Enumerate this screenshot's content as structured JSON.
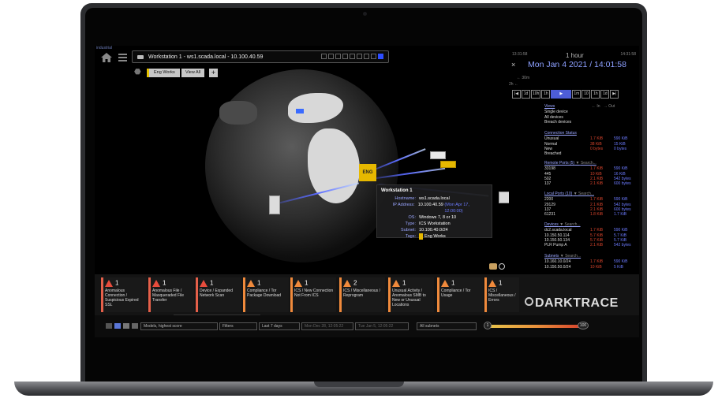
{
  "app": {
    "top_label": "industrial",
    "device_title": "Workstation 1 - ws1.scada.local - 10.100.40.59",
    "tag_chip": "Eng Works",
    "view_all": "View All",
    "add": "+"
  },
  "graph": {
    "eng_node_label": "ENG"
  },
  "tooltip": {
    "title": "Workstation 1",
    "rows": [
      {
        "k": "Hostname:",
        "v": "ws1.scada.local",
        "extra": ""
      },
      {
        "k": "IP Address:",
        "v": "10.100.40.59",
        "extra": "(Mon Apr 17, 12:00:00)"
      },
      {
        "k": "OS:",
        "v": "Windows 7, 8 or 10",
        "extra": ""
      },
      {
        "k": "Type:",
        "v": "ICS Workstation",
        "extra": ""
      },
      {
        "k": "Subnet:",
        "v": "10.100.40.0/24",
        "extra": ""
      },
      {
        "k": "Tags:",
        "v": "Eng Works",
        "extra": ""
      }
    ]
  },
  "time": {
    "left_time": "13:31:58",
    "range": "1 hour",
    "right_time": "14:31:58",
    "date": "Mon Jan 4 2021 / 14:01:58",
    "zoom1": "← 30m",
    "zoom2": "2h ←",
    "controls": [
      "|◀",
      "1d",
      "10h",
      "1h",
      "▶",
      "1m",
      "10",
      "1h",
      "1d",
      "▶|"
    ]
  },
  "panel": {
    "views": {
      "header": "Views",
      "items": [
        "Single device",
        "All devices",
        "Breach devices"
      ],
      "in_label": "← In",
      "out_label": "→ Out"
    },
    "connection_status": {
      "header": "Connection Status",
      "rows": [
        {
          "n": "Unusual",
          "a": "1.7 KiB",
          "b": "590 KiB"
        },
        {
          "n": "Normal",
          "a": "38 KiB",
          "b": "15 KiB"
        },
        {
          "n": "New",
          "a": "0 bytes",
          "b": "0 bytes"
        },
        {
          "n": "Breached",
          "a": "",
          "b": ""
        }
      ]
    },
    "remote_ports": {
      "header": "Remote Ports (5)",
      "search": "Search...",
      "rows": [
        {
          "n": "33198",
          "a": "1.7 KiB",
          "b": "590 KiB"
        },
        {
          "n": "445",
          "a": "10 KiB",
          "b": "16 KiB"
        },
        {
          "n": "502",
          "a": "2.1 KiB",
          "b": "542 bytes"
        },
        {
          "n": "137",
          "a": "2.1 KiB",
          "b": "600 bytes"
        }
      ]
    },
    "local_ports": {
      "header": "Local Ports (10)",
      "search": "Search...",
      "rows": [
        {
          "n": "2200",
          "a": "1.7 KiB",
          "b": "590 KiB"
        },
        {
          "n": "29129",
          "a": "2.1 KiB",
          "b": "542 bytes"
        },
        {
          "n": "137",
          "a": "2.1 KiB",
          "b": "600 bytes"
        },
        {
          "n": "61231",
          "a": "1.8 KiB",
          "b": "1.7 KiB"
        }
      ]
    },
    "devices": {
      "header": "Devices",
      "search": "Search...",
      "rows": [
        {
          "n": "dc2.scada.local",
          "a": "1.7 KiB",
          "b": "590 KiB"
        },
        {
          "n": "10.150.50.114",
          "a": "5.7 KiB",
          "b": "5.7 KiB"
        },
        {
          "n": "10.150.50.134",
          "a": "5.7 KiB",
          "b": "5.7 KiB"
        },
        {
          "n": "PLR Pump A",
          "a": "2.1 KiB",
          "b": "542 bytes"
        }
      ]
    },
    "subnets": {
      "header": "Subnets",
      "search": "Search...",
      "rows": [
        {
          "n": "10.160.10.0/24",
          "a": "1.7 KiB",
          "b": "590 KiB"
        },
        {
          "n": "10.150.50.0/24",
          "a": "10 KiB",
          "b": "5 KiB"
        }
      ]
    }
  },
  "alerts": [
    {
      "count": "1",
      "text": "Anomalous Connection / Suspicious Expired SSL",
      "color": "red"
    },
    {
      "count": "1",
      "text": "Anomalous File / Masqueraded File Transfer",
      "color": "red"
    },
    {
      "count": "1",
      "text": "Device / Expanded Network Scan",
      "color": "red"
    },
    {
      "count": "1",
      "text": "Compliance / Tor Package Download",
      "color": "orange"
    },
    {
      "count": "1",
      "text": "ICS / New Connection Not From ICS",
      "color": "orange"
    },
    {
      "count": "2",
      "text": "ICS / Miscellaneous / Reprogram",
      "color": "orange"
    },
    {
      "count": "1",
      "text": "Unusual Activity / Anomalous SMB to New or Unusual Locations",
      "color": "orange"
    },
    {
      "count": "1",
      "text": "Compliance / Tor Usage",
      "color": "orange"
    },
    {
      "count": "1",
      "text": "ICS / Miscellaneous / Errors",
      "color": "orange"
    }
  ],
  "brand": {
    "name": "DARKTRACE"
  },
  "footer": {
    "models": "Models, highest score",
    "filters": "Filters",
    "range": "Last 7 days",
    "from": "Mon Dec 28, 12:05:22",
    "to": "Tue Jan 5, 12:05:22",
    "subnets": "All subnets",
    "min": "1",
    "max": "100"
  },
  "colors": {
    "accent": "#5a6bff",
    "alert_red": "#e74c3c",
    "alert_orange": "#f08a3c",
    "eng_tag": "#e6b800"
  }
}
